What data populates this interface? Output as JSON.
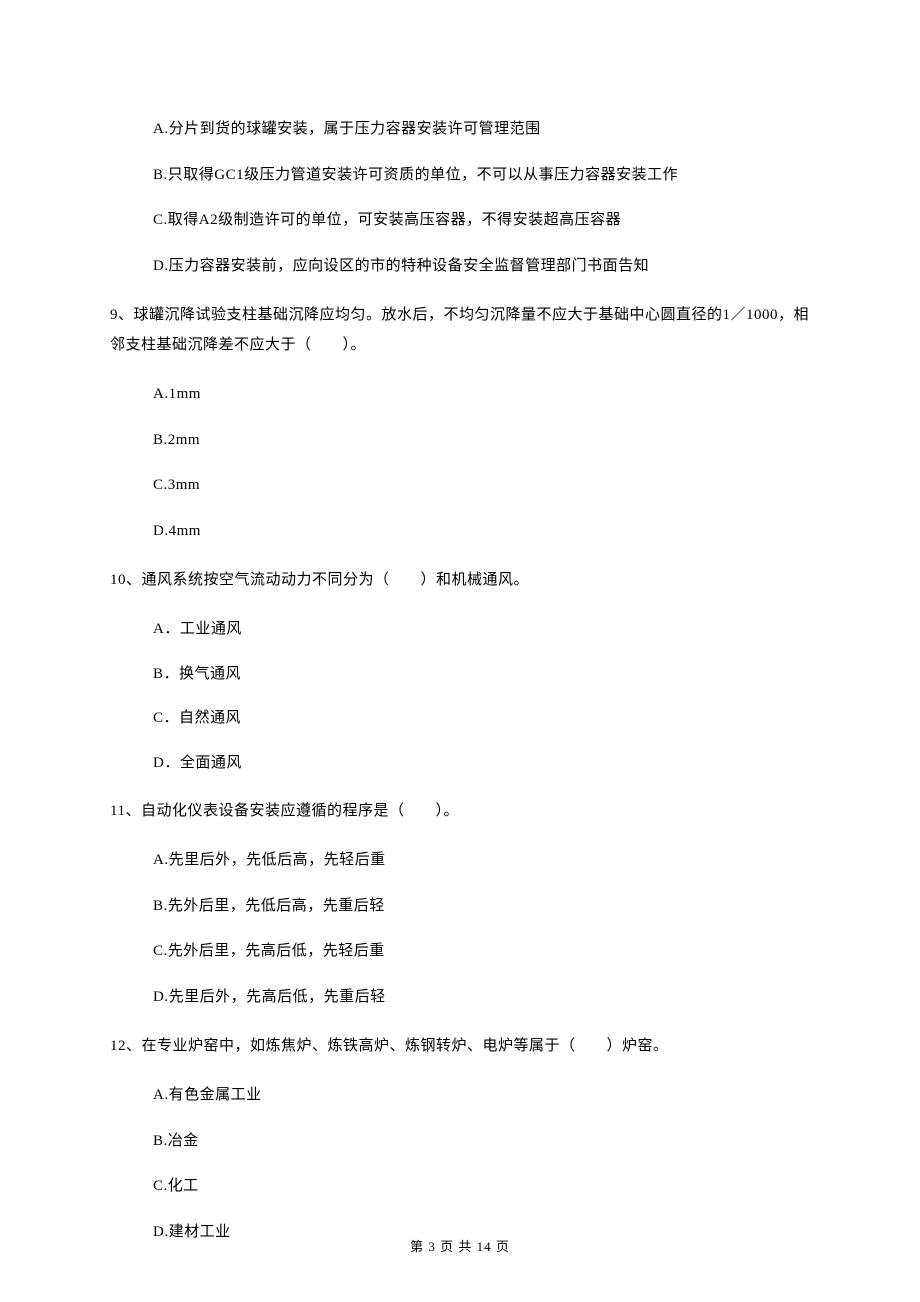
{
  "q8": {
    "a": "A.分片到货的球罐安装，属于压力容器安装许可管理范围",
    "b": "B.只取得GC1级压力管道安装许可资质的单位，不可以从事压力容器安装工作",
    "c": "C.取得A2级制造许可的单位，可安装高压容器，不得安装超高压容器",
    "d": "D.压力容器安装前，应向设区的市的特种设备安全监督管理部门书面告知"
  },
  "q9": {
    "stem": "9、球罐沉降试验支柱基础沉降应均匀。放水后，不均匀沉降量不应大于基础中心圆直径的1／1000，相邻支柱基础沉降差不应大于（　　）。",
    "a": "A.1mm",
    "b": "B.2mm",
    "c": "C.3mm",
    "d": "D.4mm"
  },
  "q10": {
    "stem": "10、通风系统按空气流动动力不同分为（　　）和机械通风。",
    "a": "A．工业通风",
    "b": "B．换气通风",
    "c": "C．自然通风",
    "d": "D．全面通风"
  },
  "q11": {
    "stem": "11、自动化仪表设备安装应遵循的程序是（　　）。",
    "a": "A.先里后外，先低后高，先轻后重",
    "b": "B.先外后里，先低后高，先重后轻",
    "c": "C.先外后里，先高后低，先轻后重",
    "d": "D.先里后外，先高后低，先重后轻"
  },
  "q12": {
    "stem": "12、在专业炉窑中，如炼焦炉、炼铁高炉、炼钢转炉、电炉等属于（　　）炉窑。",
    "a": "A.有色金属工业",
    "b": "B.冶金",
    "c": "C.化工",
    "d": "D.建材工业"
  },
  "footer": "第 3 页 共 14 页"
}
